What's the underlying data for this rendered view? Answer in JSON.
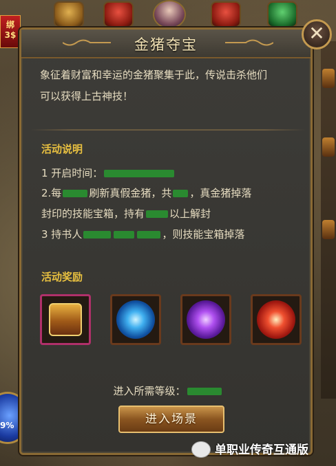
{
  "dialog": {
    "title": "金猪夺宝",
    "close_label": "✕",
    "intro_line1": "象征着财富和幸运的金猪聚集于此，传说击杀他们",
    "intro_line2": "可以获得上古神技！",
    "section_activity": "活动说明",
    "line1_prefix": "1 开启时间：",
    "line2_prefix": "2.每",
    "line2_mid": "刷新真假金猪，共",
    "line2_suffix": "，真金猪掉落",
    "line3_prefix": "封印的技能宝箱，持有",
    "line3_suffix": "以上解封",
    "line4_prefix": "3 持书人",
    "line4_suffix": "，则技能宝箱掉落",
    "section_rewards": "活动奖励",
    "rewards": [
      {
        "icon": "treasure-chest"
      },
      {
        "icon": "blue-skill-orb"
      },
      {
        "icon": "purple-skill-orb"
      },
      {
        "icon": "red-skill-orb"
      }
    ],
    "level_prefix": "进入所需等级：",
    "enter_label": "进入场景"
  },
  "side_badge": "绑\n3$",
  "orb_percent": "9%",
  "watermark": "单职业传奇互通版",
  "colors": {
    "accent_gold": "#e8c040",
    "highlight_green": "#2a8a30"
  }
}
